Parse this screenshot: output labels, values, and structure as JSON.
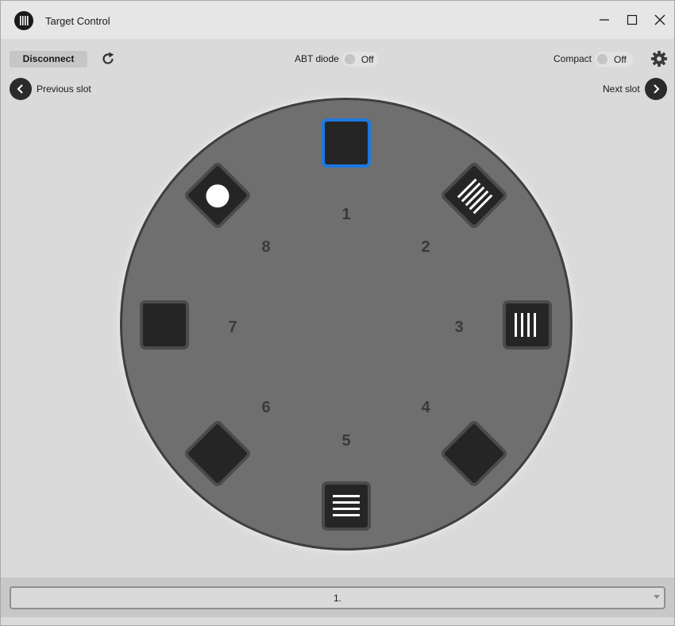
{
  "window": {
    "title": "Target Control",
    "icon": "barcode-logo-icon",
    "controls": [
      "minimize-icon",
      "maximize-icon",
      "close-icon"
    ]
  },
  "toolbar": {
    "disconnect_label": "Disconnect",
    "refresh_icon": "refresh-icon",
    "abt_diode": {
      "label": "ABT diode",
      "state": "Off"
    },
    "compact": {
      "label": "Compact",
      "state": "Off"
    },
    "settings_icon": "gear-icon"
  },
  "navigation": {
    "previous_label": "Previous slot",
    "next_label": "Next slot"
  },
  "wheel": {
    "selected_slot": "1",
    "slots": [
      {
        "number": "1",
        "pattern": "blank"
      },
      {
        "number": "2",
        "pattern": "stripes"
      },
      {
        "number": "3",
        "pattern": "stripes"
      },
      {
        "number": "4",
        "pattern": "blank"
      },
      {
        "number": "5",
        "pattern": "stripes"
      },
      {
        "number": "6",
        "pattern": "blank"
      },
      {
        "number": "7",
        "pattern": "blank"
      },
      {
        "number": "8",
        "pattern": "dot"
      }
    ]
  },
  "slot_select": {
    "value": "1."
  },
  "colors": {
    "selected_border": "#1e78e0",
    "wheel_fill": "#6f6f6f",
    "slot_fill": "#252525"
  }
}
